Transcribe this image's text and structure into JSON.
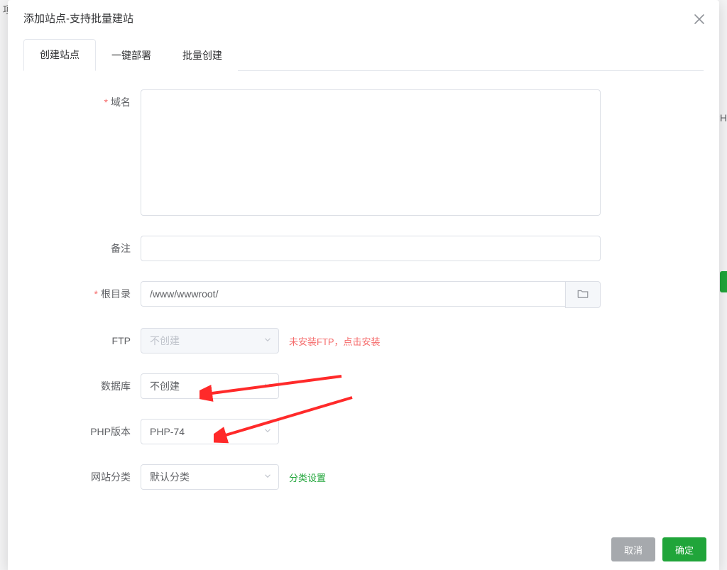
{
  "dialog_title": "添加站点-支持批量建站",
  "tabs": [
    "创建站点",
    "一键部署",
    "批量创建"
  ],
  "labels": {
    "domain": "域名",
    "remark": "备注",
    "root": "根目录",
    "ftp": "FTP",
    "db": "数据库",
    "php": "PHP版本",
    "category": "网站分类"
  },
  "values": {
    "root": "/www/wwwroot/ ",
    "ftp": "不创建",
    "db": "不创建",
    "php": "PHP-74",
    "category": "默认分类"
  },
  "hints": {
    "ftp": "未安装FTP，点击安装",
    "category": "分类设置"
  },
  "footer": {
    "cancel": "取消",
    "ok": "确定"
  },
  "bg": {
    "frag": "项",
    "side_txt": "PH"
  }
}
